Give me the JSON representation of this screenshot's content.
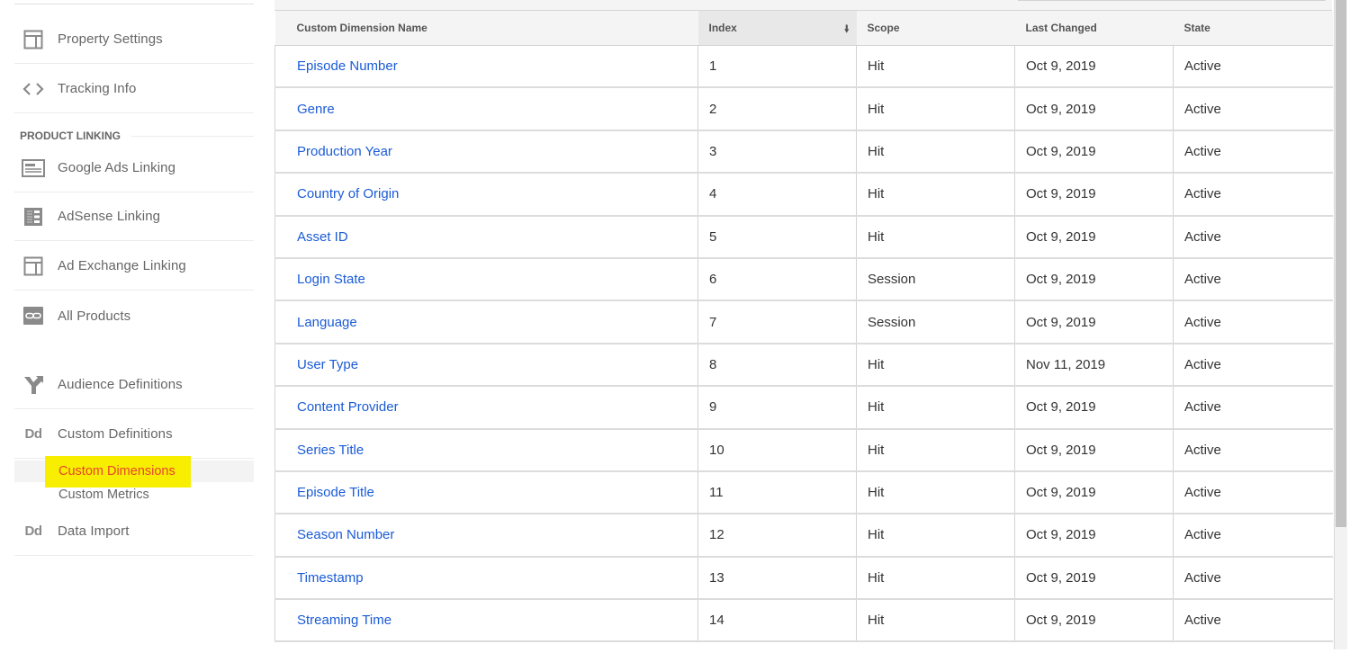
{
  "sidebar": {
    "items": [
      {
        "label": "Property Settings",
        "icon": "property-settings-icon"
      },
      {
        "label": "Tracking Info",
        "icon": "code-brackets-icon"
      }
    ],
    "product_linking_header": "PRODUCT LINKING",
    "product_linking_items": [
      {
        "label": "Google Ads Linking",
        "icon": "google-ads-icon"
      },
      {
        "label": "AdSense Linking",
        "icon": "adsense-icon"
      },
      {
        "label": "Ad Exchange Linking",
        "icon": "ad-exchange-icon"
      },
      {
        "label": "All Products",
        "icon": "link-icon"
      }
    ],
    "audience_definitions": {
      "label": "Audience Definitions",
      "icon": "audience-fork-icon"
    },
    "custom_definitions": {
      "label": "Custom Definitions",
      "icon_text": "Dd"
    },
    "custom_definitions_sub": [
      {
        "label": "Custom Dimensions",
        "active": true
      },
      {
        "label": "Custom Metrics",
        "active": false
      }
    ],
    "data_import": {
      "label": "Data Import",
      "icon_text": "Dd"
    }
  },
  "table": {
    "columns": [
      "Custom Dimension Name",
      "Index",
      "Scope",
      "Last Changed",
      "State"
    ],
    "sort_column": "Index",
    "sort_direction": "descending-arrow",
    "rows": [
      {
        "name": "Episode Number",
        "index": "1",
        "scope": "Hit",
        "last_changed": "Oct 9, 2019",
        "state": "Active"
      },
      {
        "name": "Genre",
        "index": "2",
        "scope": "Hit",
        "last_changed": "Oct 9, 2019",
        "state": "Active"
      },
      {
        "name": "Production Year",
        "index": "3",
        "scope": "Hit",
        "last_changed": "Oct 9, 2019",
        "state": "Active"
      },
      {
        "name": "Country of Origin",
        "index": "4",
        "scope": "Hit",
        "last_changed": "Oct 9, 2019",
        "state": "Active"
      },
      {
        "name": "Asset ID",
        "index": "5",
        "scope": "Hit",
        "last_changed": "Oct 9, 2019",
        "state": "Active"
      },
      {
        "name": "Login State",
        "index": "6",
        "scope": "Session",
        "last_changed": "Oct 9, 2019",
        "state": "Active"
      },
      {
        "name": "Language",
        "index": "7",
        "scope": "Session",
        "last_changed": "Oct 9, 2019",
        "state": "Active"
      },
      {
        "name": "User Type",
        "index": "8",
        "scope": "Hit",
        "last_changed": "Nov 11, 2019",
        "state": "Active"
      },
      {
        "name": "Content Provider",
        "index": "9",
        "scope": "Hit",
        "last_changed": "Oct 9, 2019",
        "state": "Active"
      },
      {
        "name": "Series Title",
        "index": "10",
        "scope": "Hit",
        "last_changed": "Oct 9, 2019",
        "state": "Active"
      },
      {
        "name": "Episode Title",
        "index": "11",
        "scope": "Hit",
        "last_changed": "Oct 9, 2019",
        "state": "Active"
      },
      {
        "name": "Season Number",
        "index": "12",
        "scope": "Hit",
        "last_changed": "Oct 9, 2019",
        "state": "Active"
      },
      {
        "name": "Timestamp",
        "index": "13",
        "scope": "Hit",
        "last_changed": "Oct 9, 2019",
        "state": "Active"
      },
      {
        "name": "Streaming Time",
        "index": "14",
        "scope": "Hit",
        "last_changed": "Oct 9, 2019",
        "state": "Active"
      }
    ]
  },
  "colors": {
    "link": "#1a5bd6",
    "active_nav": "#e8452c",
    "highlight": "#f8ee00"
  }
}
